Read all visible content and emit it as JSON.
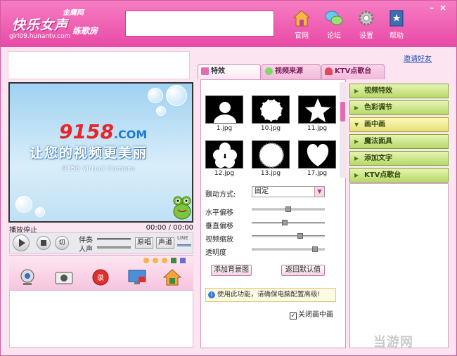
{
  "header": {
    "brand_small": "金鹰网",
    "brand_big": "快乐女声",
    "brand_sub": "练歌房",
    "url": "girl09.hunantv.com",
    "nav": [
      {
        "label": "官网",
        "icon": "home-icon"
      },
      {
        "label": "论坛",
        "icon": "forum-icon"
      },
      {
        "label": "设置",
        "icon": "gear-icon"
      },
      {
        "label": "帮助",
        "icon": "help-book-icon"
      }
    ],
    "minimize": "–",
    "close": "×"
  },
  "invite": "邀请好友",
  "tabs": [
    {
      "label": "特效",
      "active": true
    },
    {
      "label": "视频来源",
      "active": false
    },
    {
      "label": "KTV点歌台",
      "active": false
    }
  ],
  "video": {
    "brand_num": "9158",
    "brand_com": ".COM",
    "slogan": "让您的视频更美丽",
    "subtitle": "9158 Virtual Camera",
    "status": "播放停止",
    "time": "00:00 / 00:00"
  },
  "controls": {
    "accompany_label": "伴奏",
    "vocal_label": "人声",
    "original_btn": "原唱",
    "track_btn": "声道",
    "line_label": "LINE",
    "switch_label": "切"
  },
  "effects": {
    "thumbnails": [
      {
        "caption": "1.jpg",
        "shape": "silhouette"
      },
      {
        "caption": "10.jpg",
        "shape": "swirl"
      },
      {
        "caption": "11.jpg",
        "shape": "star"
      },
      {
        "caption": "12.jpg",
        "shape": "flower"
      },
      {
        "caption": "13.jpg",
        "shape": "scallop"
      },
      {
        "caption": "17.jpg",
        "shape": "heart"
      }
    ],
    "motion_label": "飘动方式:",
    "motion_value": "固定",
    "h_offset_label": "水平偏移",
    "v_offset_label": "垂直偏移",
    "zoom_label": "视频缩放",
    "opacity_label": "透明度",
    "h_offset": 0.5,
    "v_offset": 0.45,
    "zoom": 0.68,
    "opacity": 0.9,
    "add_bg_btn": "添加背景图",
    "reset_btn": "返回默认值",
    "info": "使用此功能，请确保电脑配置高级!",
    "close_pip_label": "关闭画中画",
    "close_pip_checked": true
  },
  "menu": [
    {
      "label": "视频特效",
      "open": false
    },
    {
      "label": "色彩调节",
      "open": false
    },
    {
      "label": "画中画",
      "open": true
    },
    {
      "label": "魔法面具",
      "open": false
    },
    {
      "label": "添加文字",
      "open": false
    },
    {
      "label": "KTV点歌台",
      "open": false
    }
  ],
  "colors": {
    "header_pink": "#e84aa6",
    "panel_pink": "#fce4f1",
    "menu_green": "#b7d96a",
    "link_blue": "#1e4fb6"
  },
  "watermark": "当游网"
}
